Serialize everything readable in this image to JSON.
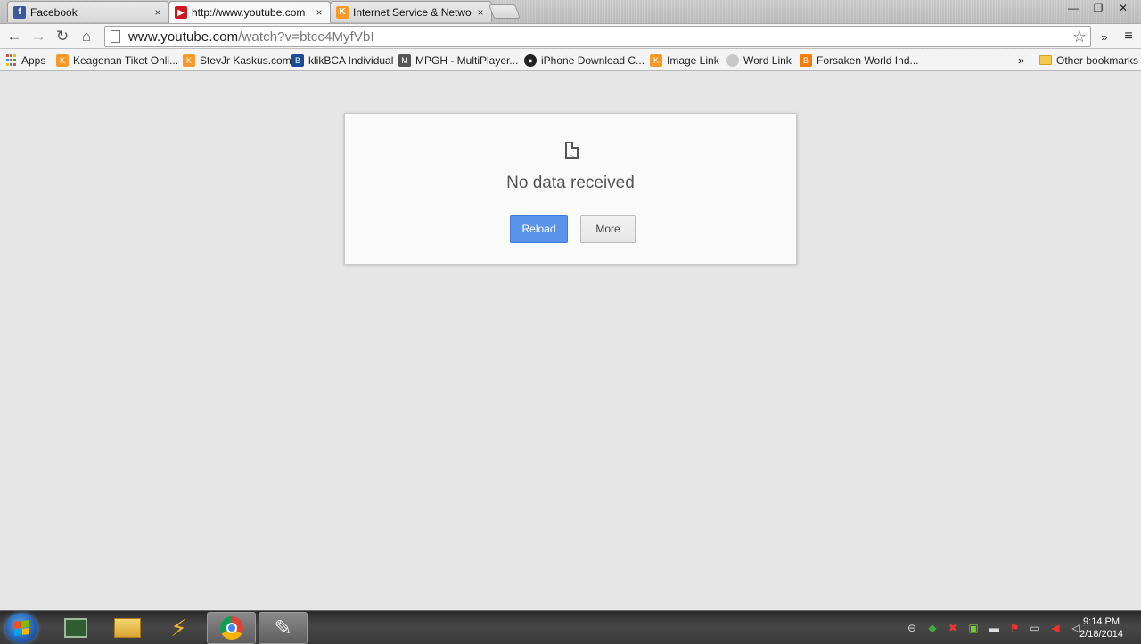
{
  "browser": {
    "tabs": [
      {
        "title": "Facebook",
        "favicon": "facebook-icon",
        "color": "#3b5998",
        "active": false
      },
      {
        "title": "http://www.youtube.com",
        "favicon": "youtube-icon",
        "color": "#cc181e",
        "active": true
      },
      {
        "title": "Internet Service & Networ",
        "favicon": "kaskus-icon",
        "color": "#f79a2a",
        "active": false
      }
    ],
    "tab_close_glyph": "×",
    "window_controls": {
      "minimize": "—",
      "restore": "❐",
      "close": "✕"
    },
    "nav": {
      "back": "←",
      "forward": "→",
      "reload": "↻",
      "home": "⌂"
    },
    "address": {
      "host": "www.youtube.com",
      "path": "/watch?v=btcc4MyfVbI"
    },
    "star_glyph": "☆",
    "overflow_glyph": "»",
    "menu_glyph": "≡"
  },
  "bookmarks": {
    "items": [
      {
        "label": "Apps",
        "icon": "apps-grid-icon",
        "color": "#e44"
      },
      {
        "label": "Keagenan Tiket Onli...",
        "icon": "kaskus-icon",
        "color": "#f79a2a"
      },
      {
        "label": "StevJr Kaskus.com",
        "icon": "kaskus-icon",
        "color": "#f79a2a"
      },
      {
        "label": "klikBCA Individual",
        "icon": "bca-icon",
        "color": "#1b4a96"
      },
      {
        "label": "MPGH - MultiPlayer...",
        "icon": "mpgh-icon",
        "color": "#555"
      },
      {
        "label": "iPhone Download C...",
        "icon": "panda-icon",
        "color": "#222"
      },
      {
        "label": "Image Link",
        "icon": "kaskus-icon",
        "color": "#f79a2a"
      },
      {
        "label": "Word Link",
        "icon": "cloud-icon",
        "color": "#bbb"
      },
      {
        "label": "Forsaken World Ind...",
        "icon": "blogger-icon",
        "color": "#f57d00"
      }
    ],
    "overflow_glyph": "»",
    "other": "Other bookmarks"
  },
  "error": {
    "title": "No data received",
    "reload_label": "Reload",
    "more_label": "More",
    "reload_color": "#5a94ea"
  },
  "taskbar": {
    "apps": [
      {
        "name": "task-manager-icon",
        "glyph": "▤"
      },
      {
        "name": "file-explorer-icon",
        "glyph": "▦"
      },
      {
        "name": "winamp-icon",
        "glyph": "⚡"
      },
      {
        "name": "chrome-icon",
        "glyph": "◉"
      },
      {
        "name": "paint-icon",
        "glyph": "✎"
      }
    ],
    "tray_glyphs": [
      "⊖",
      "◆",
      "✖",
      "▣",
      "▬",
      "⚑",
      "▭",
      "◀",
      "◁"
    ],
    "time": "9:14 PM",
    "date": "2/18/2014"
  }
}
